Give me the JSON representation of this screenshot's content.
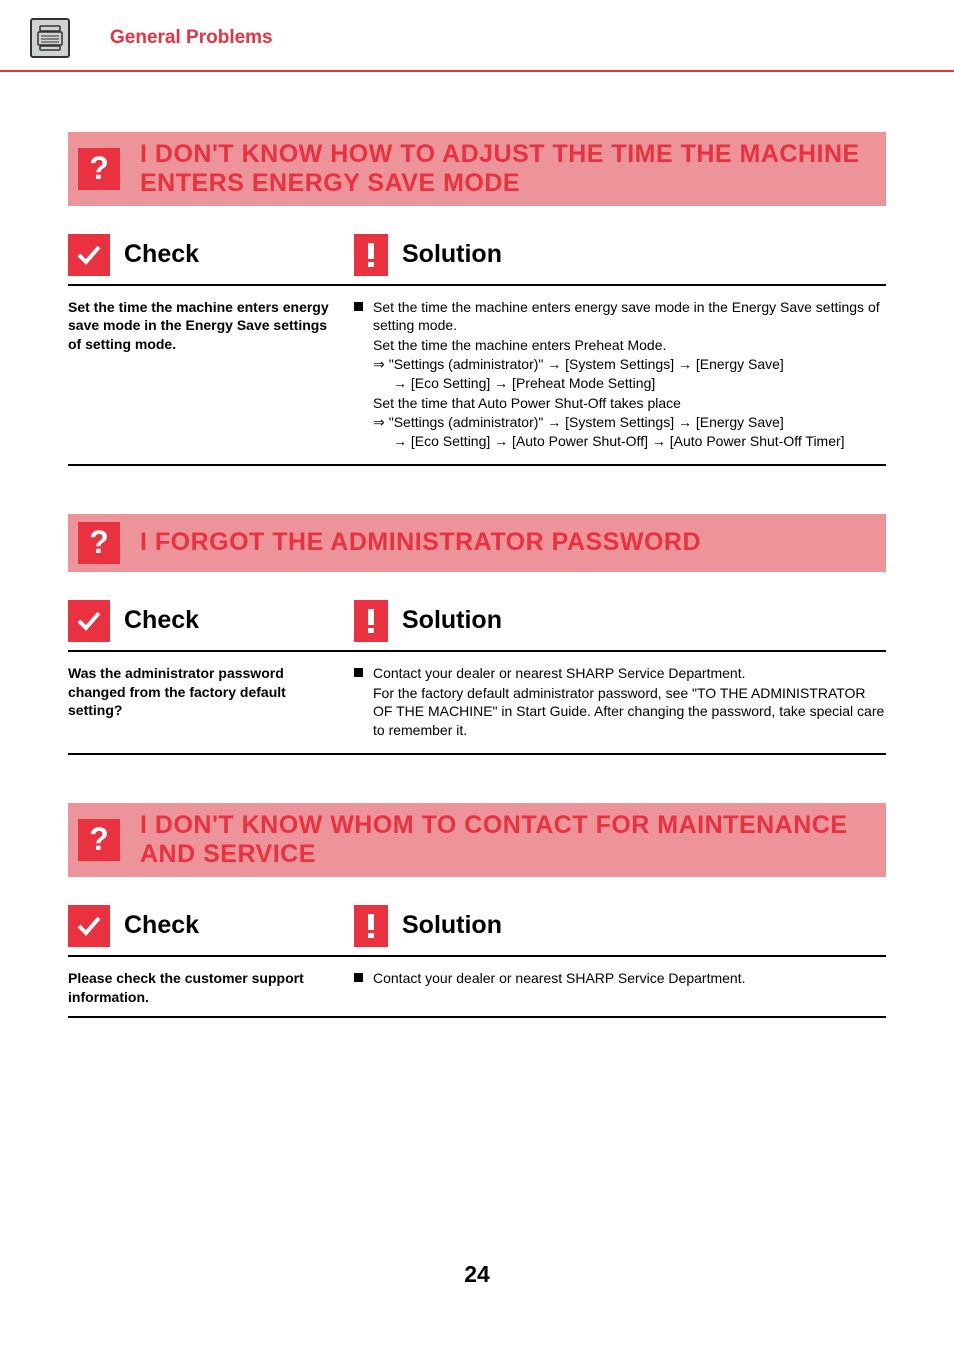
{
  "header": {
    "title": "General Problems"
  },
  "labels": {
    "check": "Check",
    "solution": "Solution"
  },
  "problems": [
    {
      "title": "I DON'T KNOW HOW TO ADJUST THE TIME THE MACHINE ENTERS ENERGY SAVE MODE",
      "check": "Set the time the machine enters energy save mode in the Energy Save settings of setting mode.",
      "solution": {
        "main": "Set the time the machine enters energy save mode in the Energy Save settings of setting mode.",
        "line1": "Set the time the machine enters Preheat Mode.",
        "path1a": "\"Settings (administrator)\" → [System Settings] → [Energy Save]",
        "path1b": "→ [Eco Setting] → [Preheat Mode Setting]",
        "line2": "Set the time that Auto Power Shut-Off takes place",
        "path2a": "\"Settings (administrator)\" → [System Settings] → [Energy Save]",
        "path2b": "→ [Eco Setting] → [Auto Power Shut-Off] → [Auto Power Shut-Off Timer]"
      }
    },
    {
      "title": "I FORGOT THE ADMINISTRATOR PASSWORD",
      "check": "Was the administrator password changed from the factory default setting?",
      "solution": {
        "main": "Contact your dealer or nearest SHARP Service Department.",
        "line1": "For the factory default administrator password, see \"TO THE ADMINISTRATOR OF THE MACHINE\" in Start Guide. After changing the password, take special care to remember it."
      }
    },
    {
      "title": "I DON'T KNOW WHOM TO CONTACT FOR MAINTENANCE AND SERVICE",
      "check": "Please check the customer support information.",
      "solution": {
        "main": "Contact your dealer or nearest SHARP Service Department."
      }
    }
  ],
  "page_number": "24"
}
